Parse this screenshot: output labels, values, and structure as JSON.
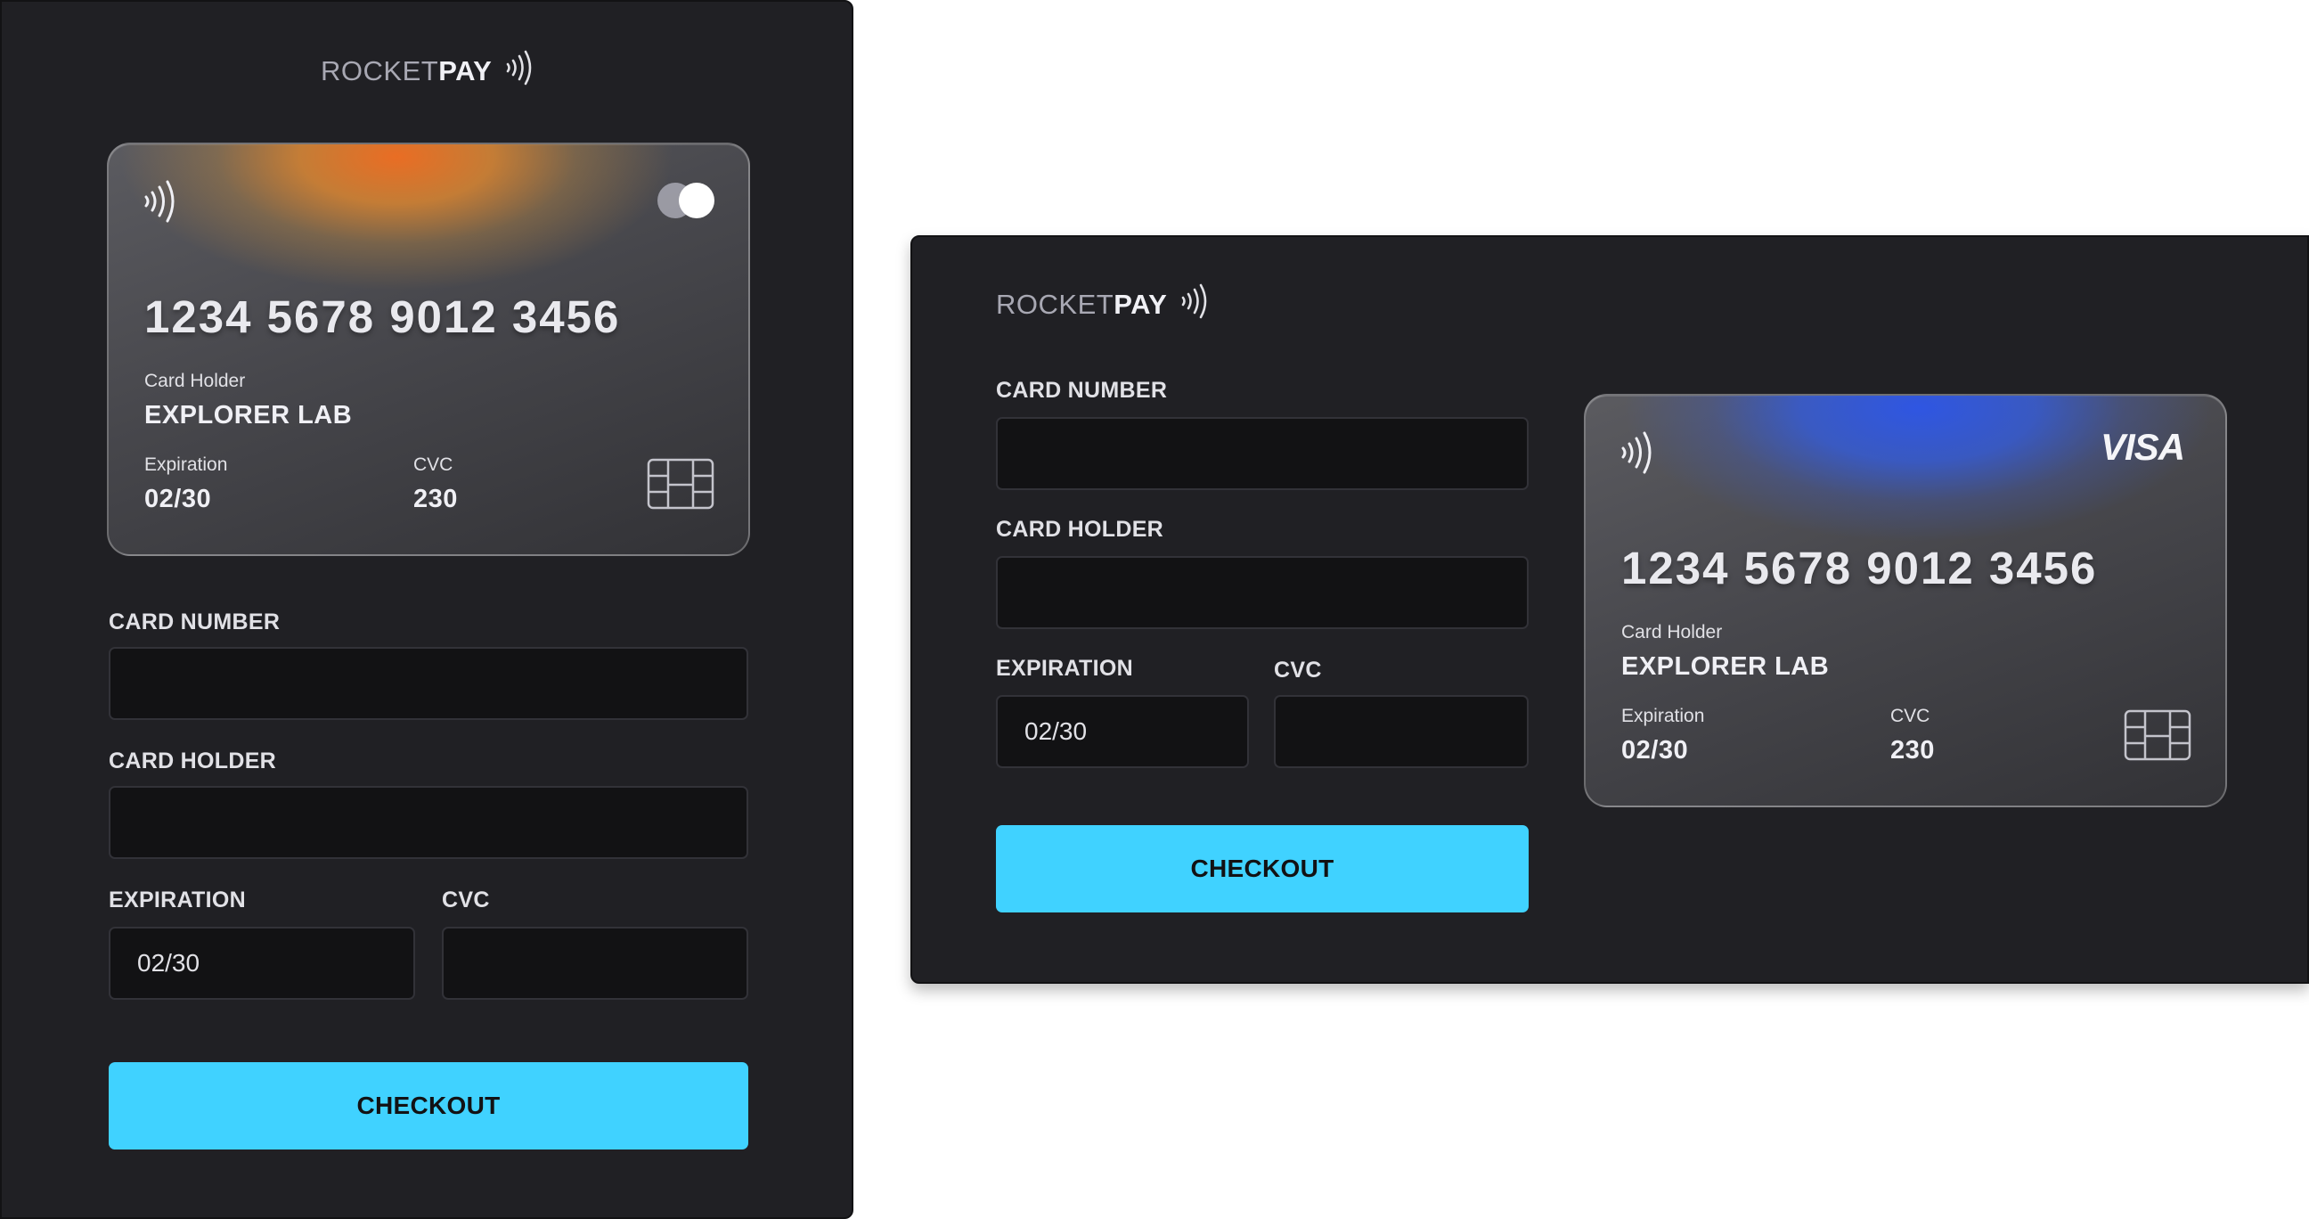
{
  "brand": {
    "name_light": "ROCKET",
    "name_bold": "PAY"
  },
  "card": {
    "number": "1234 5678 9012 3456",
    "holder_label": "Card Holder",
    "holder_value": "EXPLORER LAB",
    "expiration_label": "Expiration",
    "expiration_value": "02/30",
    "cvc_label": "CVC",
    "cvc_value": "230"
  },
  "form": {
    "card_number_label": "CARD NUMBER",
    "card_number_value": "",
    "card_holder_label": "CARD HOLDER",
    "card_holder_value": "",
    "expiration_label": "EXPIRATION",
    "expiration_value": "02/30",
    "cvc_label": "CVC",
    "cvc_value": "",
    "checkout_label": "CHECKOUT"
  },
  "mobile_card_brand": "mastercard-icon",
  "desktop_card_brand": "VISA",
  "colors": {
    "panel_bg": "#202024",
    "input_bg": "#121214",
    "accent": "#40d2ff",
    "card_glow_orange": "#e96d24",
    "card_glow_blue": "#2f56e2"
  }
}
